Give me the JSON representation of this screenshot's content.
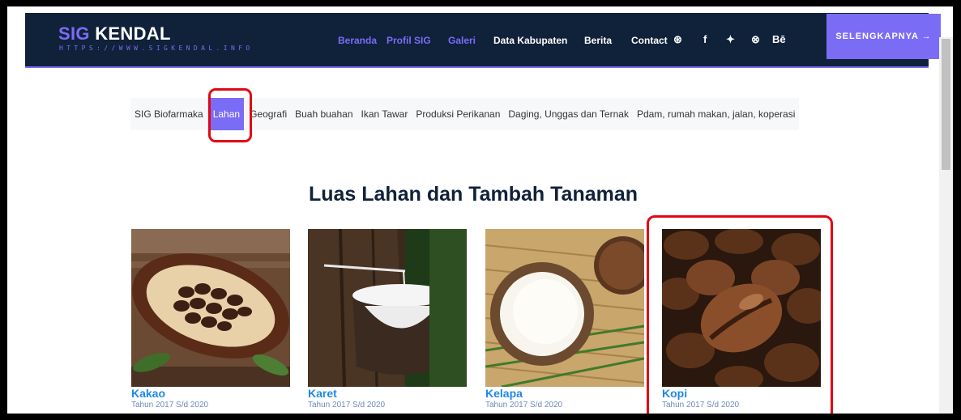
{
  "header": {
    "logo_prefix": "SIG",
    "logo_suffix": "KENDAL",
    "logo_url": "HTTPS://WWW.SIGKENDAL.INFO",
    "nav": [
      "Beranda",
      "Profil SIG",
      "Galeri",
      "Data Kabupaten",
      "Berita",
      "Contact"
    ],
    "social_icons": [
      "pinterest-icon",
      "facebook-icon",
      "twitter-icon",
      "dribbble-icon",
      "behance-icon"
    ],
    "social_glyphs": [
      "⊛",
      "f",
      "✦",
      "⊗",
      "Bē"
    ],
    "cta_label": "SELENGKAPNYA →"
  },
  "tabs": [
    "SIG Biofarmaka",
    "Lahan",
    "Geografi",
    "Buah buahan",
    "Ikan Tawar",
    "Produksi Perikanan",
    "Daging, Unggas dan Ternak",
    "Pdam, rumah makan, jalan, koperasi"
  ],
  "active_tab": "Lahan",
  "section_title": "Luas Lahan dan Tambah Tanaman",
  "cards": [
    {
      "name": "Kakao",
      "subtitle": "Tahun 2017 S/d 2020"
    },
    {
      "name": "Karet",
      "subtitle": "Tahun 2017 S/d 2020"
    },
    {
      "name": "Kelapa",
      "subtitle": "Tahun 2017 S/d 2020"
    },
    {
      "name": "Kopi",
      "subtitle": "Tahun 2017 S/d 2020"
    }
  ],
  "colors": {
    "header_bg": "#10213a",
    "accent": "#7b6cf6",
    "highlight": "#e30613",
    "card_title": "#1e88e5"
  }
}
